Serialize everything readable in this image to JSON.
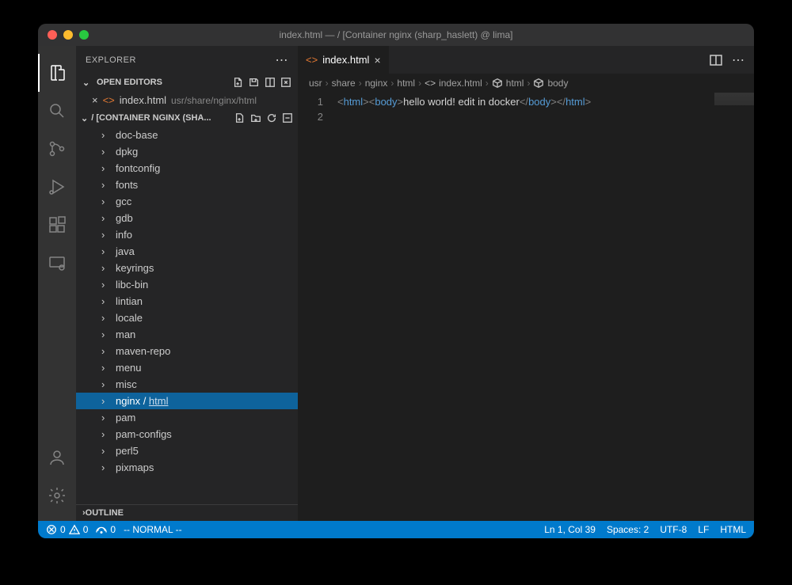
{
  "title": "index.html — / [Container nginx (sharp_haslett) @ lima]",
  "explorer": {
    "label": "EXPLORER",
    "openEditors": "OPEN EDITORS",
    "openFile": {
      "name": "index.html",
      "path": "usr/share/nginx/html"
    },
    "folderHeader": "/ [CONTAINER NGINX (SHA...",
    "outline": "OUTLINE"
  },
  "tree": [
    {
      "name": "doc-base"
    },
    {
      "name": "dpkg"
    },
    {
      "name": "fontconfig"
    },
    {
      "name": "fonts"
    },
    {
      "name": "gcc"
    },
    {
      "name": "gdb"
    },
    {
      "name": "info"
    },
    {
      "name": "java"
    },
    {
      "name": "keyrings"
    },
    {
      "name": "libc-bin"
    },
    {
      "name": "lintian"
    },
    {
      "name": "locale"
    },
    {
      "name": "man"
    },
    {
      "name": "maven-repo"
    },
    {
      "name": "menu"
    },
    {
      "name": "misc"
    },
    {
      "name": "nginx",
      "sub": "html",
      "selected": true
    },
    {
      "name": "pam"
    },
    {
      "name": "pam-configs"
    },
    {
      "name": "perl5"
    },
    {
      "name": "pixmaps"
    }
  ],
  "tab": {
    "name": "index.html"
  },
  "breadcrumb": [
    "usr",
    "share",
    "nginx",
    "html",
    "index.html",
    "html",
    "body"
  ],
  "code": {
    "lines": [
      "1",
      "2"
    ],
    "content": {
      "tag1": "html",
      "tag2": "body",
      "text": "hello world! edit in docker"
    }
  },
  "status": {
    "errors": "0",
    "warnings": "0",
    "ports": "0",
    "mode": "-- NORMAL --",
    "pos": "Ln 1, Col 39",
    "spaces": "Spaces: 2",
    "enc": "UTF-8",
    "eol": "LF",
    "lang": "HTML"
  }
}
